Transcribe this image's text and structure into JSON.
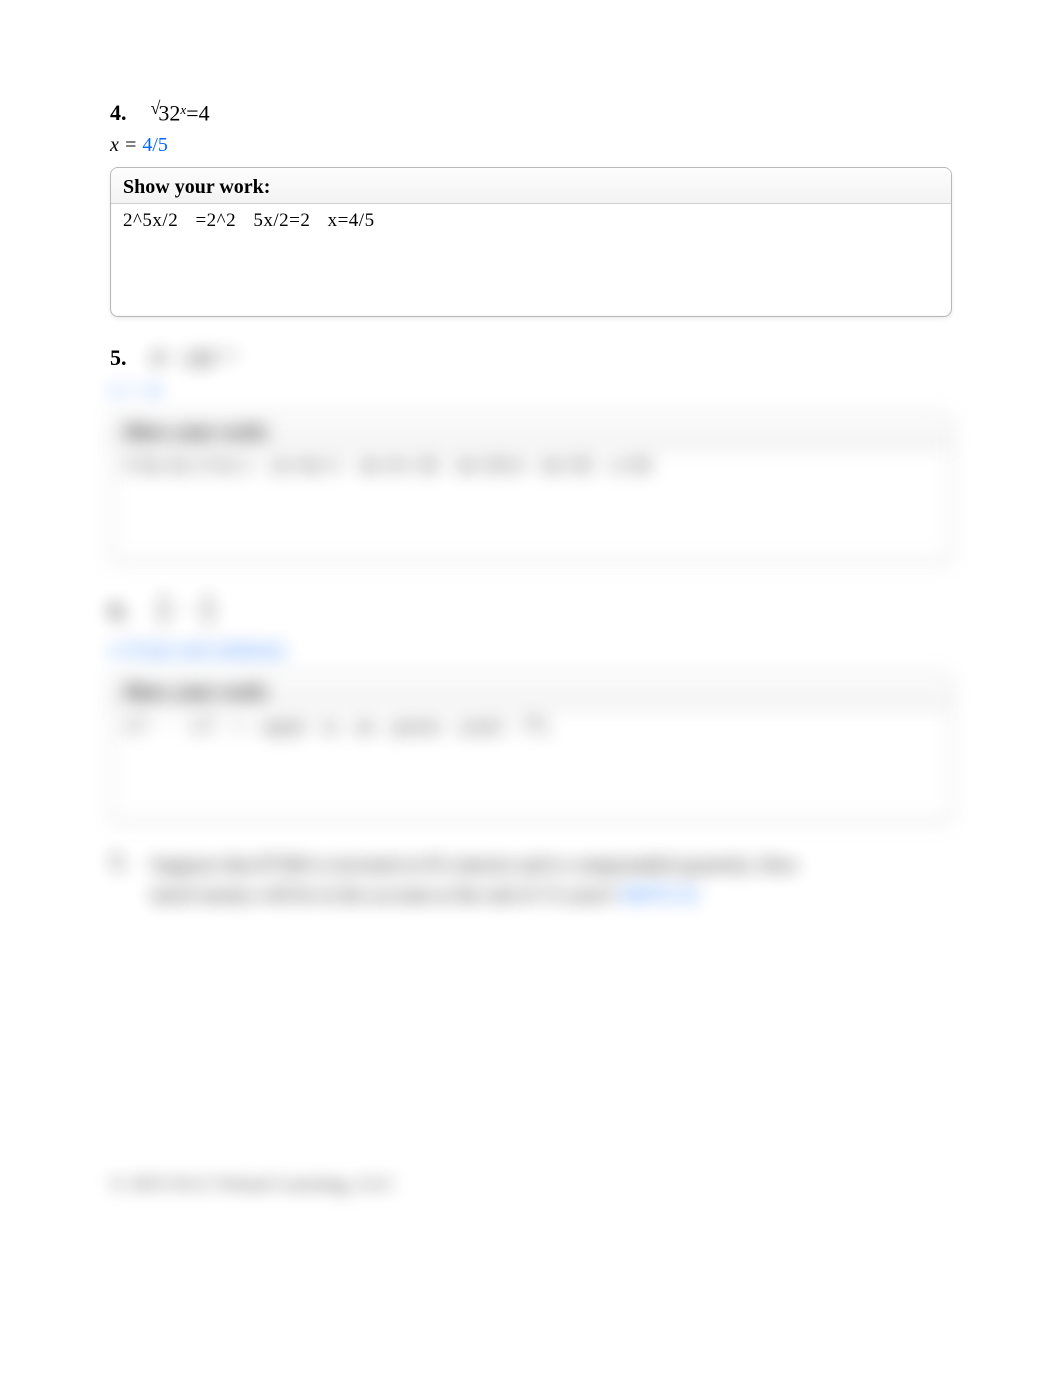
{
  "problems": [
    {
      "number": "4.",
      "equation_base": "32",
      "equation_exp": "x",
      "equation_rhs": "4",
      "sqrt_symbol": "√",
      "eq_sign": "=",
      "answer_prefix": "x = ",
      "answer_value": "4/5",
      "show_work_label": "Show your work:",
      "work_text": "2^5x/2 =2^2 5x/2=2 x=4/5"
    },
    {
      "number": "5.",
      "equation_text": "4ˣ · (4)ˣ⁻¹",
      "answer_prefix": "x = ",
      "answer_value": "-4",
      "show_work_label": "Show your work:",
      "work_text": "2^4x·4x·2^2x-1   2x+4x=1   4x+4=-20   4x=20-4   4x=20   x=20"
    },
    {
      "number": "6.",
      "equation_text": "",
      "frac1_num": "1",
      "frac1_den": "7",
      "frac2_num": "1",
      "frac2_den": "7",
      "answer_prefix": "",
      "answer_value": "x=0 (no real solution)",
      "show_work_label": "Show your work:",
      "work_text": "1/7 · 1/7 = equal to no power (can't 7⁰)"
    },
    {
      "number": "7.",
      "question_text": "Suppose that $7500 is invested at 6% interest and is compounded quarterly. How much money will be in the account at the end of 15 years? ",
      "answer_value": "$4970.34"
    }
  ],
  "footer": "© 2015 K12 Virtual Learning, LLC"
}
